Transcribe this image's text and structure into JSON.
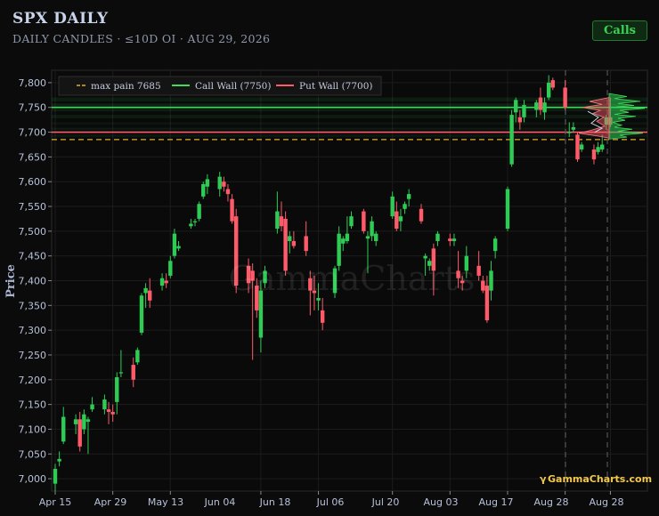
{
  "header": {
    "title": "SPX DAILY",
    "subtitle": "DAILY CANDLES · ≤10D OI · AUG 29, 2026",
    "calls_button": "Calls"
  },
  "watermark": "GammaCharts",
  "brand_glyph": "γ",
  "brand": "GammaCharts.com",
  "colors": {
    "up": "#2ecc55",
    "down": "#ff5a6a",
    "call_wall": "#3fdc5a",
    "put_wall": "#ff5a6a",
    "max_pain": "#e0b02a",
    "background": "#0b0b0b"
  },
  "chart_data": {
    "type": "candlestick",
    "ylabel": "Price",
    "ylim": [
      6975,
      7825
    ],
    "yticks": [
      7000,
      7050,
      7100,
      7150,
      7200,
      7250,
      7300,
      7350,
      7400,
      7450,
      7500,
      7550,
      7600,
      7650,
      7700,
      7750,
      7800
    ],
    "ytick_labels": [
      "7,000",
      "7,050",
      "7,100",
      "7,150",
      "7,200",
      "7,250",
      "7,300",
      "7,350",
      "7,400",
      "7,450",
      "7,500",
      "7,550",
      "7,600",
      "7,650",
      "7,700",
      "7,750",
      "7,800"
    ],
    "xlim": [
      "2026-04-15",
      "2026-09-06"
    ],
    "xticks": [
      "2026-04-15",
      "2026-04-29",
      "2026-05-13",
      "2026-06-04",
      "2026-06-18",
      "2026-07-06",
      "2026-07-20",
      "2026-08-03",
      "2026-08-17",
      "2026-08-28",
      "2026-08-28"
    ],
    "xtick_labels": [
      "Apr 15",
      "Apr 29",
      "May 13",
      "Jun 04",
      "Jun 18",
      "Jul 06",
      "Jul 20",
      "Aug 03",
      "Aug 17",
      "Aug 28",
      "Aug 28"
    ],
    "grid": true,
    "legend": {
      "placement": "top-left",
      "entries": [
        {
          "label": "max pain 7685",
          "style": "dashed",
          "color": "#e0b02a"
        },
        {
          "label": "Call Wall (7750)",
          "style": "solid",
          "color": "#3fdc5a"
        },
        {
          "label": "Put Wall (7700)",
          "style": "solid",
          "color": "#ff5a6a"
        }
      ]
    },
    "levels": {
      "max_pain": 7685,
      "call_wall": 7750,
      "put_wall": 7700
    },
    "candles": [
      {
        "date": "2026-04-15",
        "o": 6990,
        "h": 7030,
        "l": 6975,
        "c": 7020
      },
      {
        "date": "2026-04-16",
        "o": 7035,
        "h": 7055,
        "l": 7025,
        "c": 7040
      },
      {
        "date": "2026-04-17",
        "o": 7075,
        "h": 7145,
        "l": 7070,
        "c": 7125
      },
      {
        "date": "2026-04-20",
        "o": 7110,
        "h": 7130,
        "l": 7090,
        "c": 7120
      },
      {
        "date": "2026-04-21",
        "o": 7120,
        "h": 7135,
        "l": 7055,
        "c": 7065
      },
      {
        "date": "2026-04-22",
        "o": 7100,
        "h": 7140,
        "l": 7090,
        "c": 7130
      },
      {
        "date": "2026-04-23",
        "o": 7115,
        "h": 7125,
        "l": 7050,
        "c": 7120
      },
      {
        "date": "2026-04-24",
        "o": 7140,
        "h": 7165,
        "l": 7135,
        "c": 7150
      },
      {
        "date": "2026-04-27",
        "o": 7140,
        "h": 7170,
        "l": 7130,
        "c": 7160
      },
      {
        "date": "2026-04-28",
        "o": 7140,
        "h": 7155,
        "l": 7110,
        "c": 7135
      },
      {
        "date": "2026-04-29",
        "o": 7135,
        "h": 7150,
        "l": 7115,
        "c": 7130
      },
      {
        "date": "2026-04-30",
        "o": 7155,
        "h": 7215,
        "l": 7130,
        "c": 7205
      },
      {
        "date": "2026-05-01",
        "o": 7215,
        "h": 7260,
        "l": 7205,
        "c": 7215
      },
      {
        "date": "2026-05-04",
        "o": 7230,
        "h": 7245,
        "l": 7185,
        "c": 7200
      },
      {
        "date": "2026-05-05",
        "o": 7235,
        "h": 7265,
        "l": 7230,
        "c": 7260
      },
      {
        "date": "2026-05-06",
        "o": 7295,
        "h": 7375,
        "l": 7290,
        "c": 7370
      },
      {
        "date": "2026-05-07",
        "o": 7375,
        "h": 7395,
        "l": 7345,
        "c": 7385
      },
      {
        "date": "2026-05-08",
        "o": 7380,
        "h": 7405,
        "l": 7345,
        "c": 7360
      },
      {
        "date": "2026-05-11",
        "o": 7390,
        "h": 7415,
        "l": 7380,
        "c": 7405
      },
      {
        "date": "2026-05-12",
        "o": 7400,
        "h": 7415,
        "l": 7385,
        "c": 7395
      },
      {
        "date": "2026-05-13",
        "o": 7410,
        "h": 7450,
        "l": 7405,
        "c": 7440
      },
      {
        "date": "2026-05-14",
        "o": 7450,
        "h": 7505,
        "l": 7445,
        "c": 7495
      },
      {
        "date": "2026-05-15",
        "o": 7465,
        "h": 7480,
        "l": 7460,
        "c": 7470
      },
      {
        "date": "2026-05-18",
        "o": 7510,
        "h": 7525,
        "l": 7505,
        "c": 7515
      },
      {
        "date": "2026-05-19",
        "o": 7520,
        "h": 7525,
        "l": 7510,
        "c": 7520
      },
      {
        "date": "2026-05-20",
        "o": 7525,
        "h": 7560,
        "l": 7520,
        "c": 7555
      },
      {
        "date": "2026-05-21",
        "o": 7570,
        "h": 7600,
        "l": 7565,
        "c": 7595
      },
      {
        "date": "2026-05-22",
        "o": 7590,
        "h": 7615,
        "l": 7575,
        "c": 7605
      },
      {
        "date": "2026-05-25",
        "o": 7585,
        "h": 7620,
        "l": 7570,
        "c": 7610
      },
      {
        "date": "2026-05-26",
        "o": 7600,
        "h": 7610,
        "l": 7580,
        "c": 7590
      },
      {
        "date": "2026-05-27",
        "o": 7585,
        "h": 7595,
        "l": 7560,
        "c": 7575
      },
      {
        "date": "2026-05-28",
        "o": 7565,
        "h": 7575,
        "l": 7515,
        "c": 7520
      },
      {
        "date": "2026-05-29",
        "o": 7530,
        "h": 7545,
        "l": 7375,
        "c": 7390
      },
      {
        "date": "2026-06-01",
        "o": 7430,
        "h": 7445,
        "l": 7375,
        "c": 7395
      },
      {
        "date": "2026-06-02",
        "o": 7420,
        "h": 7435,
        "l": 7240,
        "c": 7400
      },
      {
        "date": "2026-06-03",
        "o": 7390,
        "h": 7405,
        "l": 7325,
        "c": 7340
      },
      {
        "date": "2026-06-04",
        "o": 7285,
        "h": 7400,
        "l": 7255,
        "c": 7380
      },
      {
        "date": "2026-06-05",
        "o": 7395,
        "h": 7430,
        "l": 7385,
        "c": 7420
      },
      {
        "date": "2026-06-08",
        "o": 7505,
        "h": 7580,
        "l": 7495,
        "c": 7540
      },
      {
        "date": "2026-06-09",
        "o": 7530,
        "h": 7560,
        "l": 7500,
        "c": 7510
      },
      {
        "date": "2026-06-10",
        "o": 7525,
        "h": 7540,
        "l": 7410,
        "c": 7420
      },
      {
        "date": "2026-06-11",
        "o": 7480,
        "h": 7500,
        "l": 7455,
        "c": 7490
      },
      {
        "date": "2026-06-12",
        "o": 7480,
        "h": 7500,
        "l": 7465,
        "c": 7470
      },
      {
        "date": "2026-06-15",
        "o": 7490,
        "h": 7520,
        "l": 7450,
        "c": 7460
      },
      {
        "date": "2026-06-16",
        "o": 7405,
        "h": 7420,
        "l": 7330,
        "c": 7380
      },
      {
        "date": "2026-06-17",
        "o": 7380,
        "h": 7410,
        "l": 7340,
        "c": 7375
      },
      {
        "date": "2026-06-18",
        "o": 7360,
        "h": 7395,
        "l": 7340,
        "c": 7365
      },
      {
        "date": "2026-06-19",
        "o": 7340,
        "h": 7365,
        "l": 7300,
        "c": 7315
      },
      {
        "date": "2026-06-22",
        "o": 7375,
        "h": 7430,
        "l": 7365,
        "c": 7425
      },
      {
        "date": "2026-06-23",
        "o": 7430,
        "h": 7510,
        "l": 7420,
        "c": 7495
      },
      {
        "date": "2026-06-24",
        "o": 7475,
        "h": 7490,
        "l": 7460,
        "c": 7485
      },
      {
        "date": "2026-06-25",
        "o": 7480,
        "h": 7530,
        "l": 7475,
        "c": 7495
      },
      {
        "date": "2026-06-26",
        "o": 7510,
        "h": 7540,
        "l": 7505,
        "c": 7530
      },
      {
        "date": "2026-06-29",
        "o": 7540,
        "h": 7545,
        "l": 7495,
        "c": 7500
      },
      {
        "date": "2026-06-30",
        "o": 7485,
        "h": 7500,
        "l": 7415,
        "c": 7490
      },
      {
        "date": "2026-07-01",
        "o": 7490,
        "h": 7530,
        "l": 7480,
        "c": 7520
      },
      {
        "date": "2026-07-02",
        "o": 7480,
        "h": 7500,
        "l": 7470,
        "c": 7495
      },
      {
        "date": "2026-07-06",
        "o": 7530,
        "h": 7580,
        "l": 7525,
        "c": 7570
      },
      {
        "date": "2026-07-07",
        "o": 7540,
        "h": 7560,
        "l": 7500,
        "c": 7505
      },
      {
        "date": "2026-07-08",
        "o": 7520,
        "h": 7545,
        "l": 7500,
        "c": 7530
      },
      {
        "date": "2026-07-09",
        "o": 7545,
        "h": 7560,
        "l": 7535,
        "c": 7555
      },
      {
        "date": "2026-07-10",
        "o": 7565,
        "h": 7585,
        "l": 7550,
        "c": 7575
      },
      {
        "date": "2026-07-13",
        "o": 7545,
        "h": 7555,
        "l": 7515,
        "c": 7520
      },
      {
        "date": "2026-07-14",
        "o": 7445,
        "h": 7455,
        "l": 7410,
        "c": 7450
      },
      {
        "date": "2026-07-15",
        "o": 7430,
        "h": 7445,
        "l": 7420,
        "c": 7440
      },
      {
        "date": "2026-07-16",
        "o": 7465,
        "h": 7475,
        "l": 7370,
        "c": 7420
      },
      {
        "date": "2026-07-17",
        "o": 7480,
        "h": 7500,
        "l": 7470,
        "c": 7495
      },
      {
        "date": "2026-07-20",
        "o": 7485,
        "h": 7495,
        "l": 7470,
        "c": 7480
      },
      {
        "date": "2026-07-21",
        "o": 7480,
        "h": 7495,
        "l": 7470,
        "c": 7485
      },
      {
        "date": "2026-07-22",
        "o": 7420,
        "h": 7460,
        "l": 7385,
        "c": 7405
      },
      {
        "date": "2026-07-23",
        "o": 7400,
        "h": 7410,
        "l": 7380,
        "c": 7395
      },
      {
        "date": "2026-07-24",
        "o": 7420,
        "h": 7470,
        "l": 7405,
        "c": 7450
      },
      {
        "date": "2026-07-27",
        "o": 7430,
        "h": 7460,
        "l": 7400,
        "c": 7410
      },
      {
        "date": "2026-07-28",
        "o": 7400,
        "h": 7410,
        "l": 7375,
        "c": 7380
      },
      {
        "date": "2026-07-29",
        "o": 7390,
        "h": 7410,
        "l": 7315,
        "c": 7320
      },
      {
        "date": "2026-07-30",
        "o": 7380,
        "h": 7440,
        "l": 7360,
        "c": 7420
      },
      {
        "date": "2026-07-31",
        "o": 7460,
        "h": 7490,
        "l": 7445,
        "c": 7485
      },
      {
        "date": "2026-08-03",
        "o": 7505,
        "h": 7590,
        "l": 7500,
        "c": 7585
      },
      {
        "date": "2026-08-04",
        "o": 7635,
        "h": 7745,
        "l": 7630,
        "c": 7735
      },
      {
        "date": "2026-08-05",
        "o": 7740,
        "h": 7770,
        "l": 7720,
        "c": 7765
      },
      {
        "date": "2026-08-06",
        "o": 7730,
        "h": 7745,
        "l": 7705,
        "c": 7720
      },
      {
        "date": "2026-08-07",
        "o": 7730,
        "h": 7765,
        "l": 7720,
        "c": 7755
      },
      {
        "date": "2026-08-10",
        "o": 7745,
        "h": 7765,
        "l": 7730,
        "c": 7760
      },
      {
        "date": "2026-08-11",
        "o": 7770,
        "h": 7790,
        "l": 7735,
        "c": 7745
      },
      {
        "date": "2026-08-12",
        "o": 7740,
        "h": 7770,
        "l": 7725,
        "c": 7760
      },
      {
        "date": "2026-08-13",
        "o": 7770,
        "h": 7815,
        "l": 7765,
        "c": 7800
      },
      {
        "date": "2026-08-14",
        "o": 7805,
        "h": 7810,
        "l": 7785,
        "c": 7790
      },
      {
        "date": "2026-08-17",
        "o": 7790,
        "h": 7805,
        "l": 7745,
        "c": 7750
      },
      {
        "date": "2026-08-18",
        "o": 7700,
        "h": 7720,
        "l": 7690,
        "c": 7700
      },
      {
        "date": "2026-08-19",
        "o": 7705,
        "h": 7720,
        "l": 7700,
        "c": 7710
      },
      {
        "date": "2026-08-20",
        "o": 7695,
        "h": 7700,
        "l": 7640,
        "c": 7645
      },
      {
        "date": "2026-08-21",
        "o": 7665,
        "h": 7680,
        "l": 7660,
        "c": 7675
      },
      {
        "date": "2026-08-24",
        "o": 7665,
        "h": 7675,
        "l": 7635,
        "c": 7645
      },
      {
        "date": "2026-08-25",
        "o": 7660,
        "h": 7680,
        "l": 7655,
        "c": 7670
      },
      {
        "date": "2026-08-26",
        "o": 7665,
        "h": 7695,
        "l": 7660,
        "c": 7675
      },
      {
        "date": "2026-08-27",
        "o": 7715,
        "h": 7735,
        "l": 7705,
        "c": 7730
      },
      {
        "date": "2026-08-28",
        "o": 7730,
        "h": 7770,
        "l": 7710,
        "c": 7715
      }
    ],
    "forecast_markers": [
      "2026-08-28",
      "2026-09-04"
    ]
  }
}
